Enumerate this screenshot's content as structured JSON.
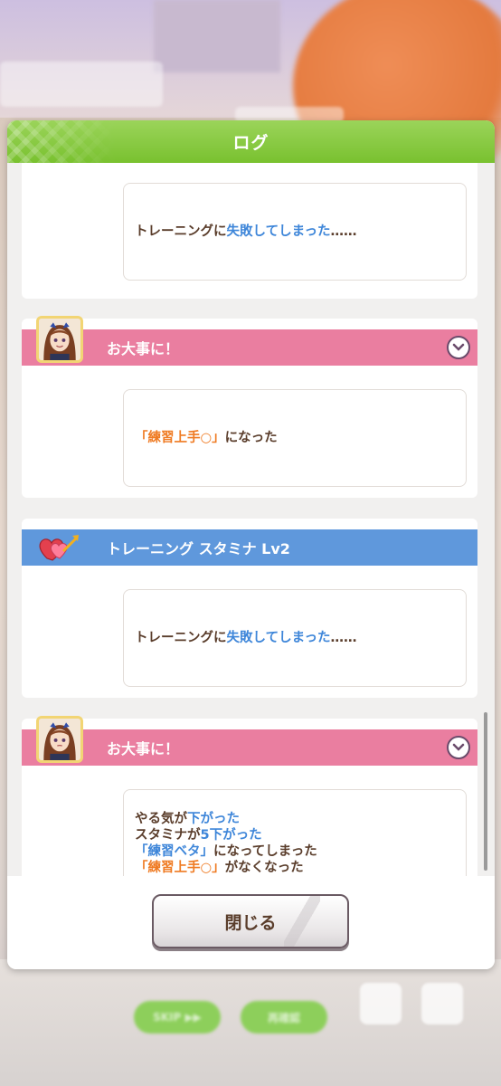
{
  "dialog": {
    "title": "ログ",
    "close_label": "閉じる"
  },
  "entries": [
    {
      "header": null,
      "lines": [
        [
          {
            "text": "トレーニングに",
            "color": "brown"
          },
          {
            "text": "失敗してしまった",
            "color": "blue"
          },
          {
            "text": "……",
            "color": "brown"
          }
        ]
      ]
    },
    {
      "header": "お大事に！",
      "header_color": "pink",
      "icon": "character-portrait",
      "lines": [
        [
          {
            "text": "「練習上手○」",
            "color": "orange"
          },
          {
            "text": "になった",
            "color": "brown"
          }
        ]
      ]
    },
    {
      "header": "トレーニング スタミナ Lv2",
      "header_color": "blue",
      "icon": "heart-arrow-icon",
      "lines": [
        [
          {
            "text": "トレーニングに",
            "color": "brown"
          },
          {
            "text": "失敗してしまった",
            "color": "blue"
          },
          {
            "text": "……",
            "color": "brown"
          }
        ]
      ]
    },
    {
      "header": "お大事に！",
      "header_color": "pink",
      "icon": "character-portrait",
      "lines": [
        [
          {
            "text": "やる気が",
            "color": "brown"
          },
          {
            "text": "下がった",
            "color": "blue"
          }
        ],
        [
          {
            "text": "スタミナが",
            "color": "brown"
          },
          {
            "text": "5下がった",
            "color": "blue"
          }
        ],
        [
          {
            "text": "「練習ベタ」",
            "color": "blue"
          },
          {
            "text": "になってしまった",
            "color": "brown"
          }
        ],
        [
          {
            "text": "「練習上手○」",
            "color": "orange"
          },
          {
            "text": "がなくなった",
            "color": "brown"
          }
        ]
      ]
    }
  ],
  "background": {
    "skip_label": "SKIP ▶▶",
    "auto_label": "再確認"
  },
  "colors": {
    "header_green": "#79c12f",
    "pink": "#ea7ea0",
    "blue_header": "#5f98dc",
    "text_brown": "#5a3d2b",
    "text_blue": "#3e86d9",
    "text_orange": "#ef7b23"
  }
}
